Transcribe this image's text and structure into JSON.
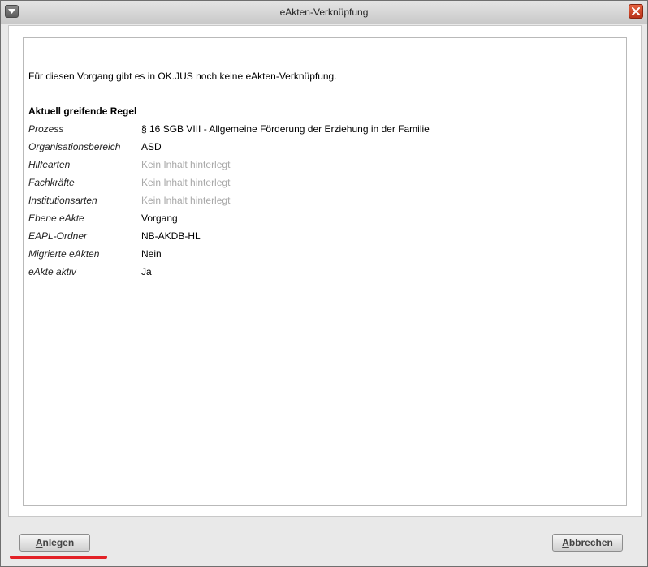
{
  "window": {
    "title": "eAkten-Verknüpfung"
  },
  "content": {
    "intro": "Für diesen Vorgang gibt es in OK.JUS noch keine eAkten-Verknüpfung.",
    "rule_heading": "Aktuell greifende Regel",
    "rows": [
      {
        "label": "Prozess",
        "value": "§ 16 SGB VIII - Allgemeine Förderung der Erziehung in der Familie",
        "empty": false
      },
      {
        "label": "Organisationsbereich",
        "value": "ASD",
        "empty": false
      },
      {
        "label": "Hilfearten",
        "value": "Kein Inhalt hinterlegt",
        "empty": true
      },
      {
        "label": "Fachkräfte",
        "value": "Kein Inhalt hinterlegt",
        "empty": true
      },
      {
        "label": "Institutionsarten",
        "value": "Kein Inhalt hinterlegt",
        "empty": true
      },
      {
        "label": "Ebene eAkte",
        "value": "Vorgang",
        "empty": false
      },
      {
        "label": "EAPL-Ordner",
        "value": "NB-AKDB-HL",
        "empty": false
      },
      {
        "label": "Migrierte eAkten",
        "value": "Nein",
        "empty": false
      },
      {
        "label": "eAkte aktiv",
        "value": "Ja",
        "empty": false
      }
    ]
  },
  "buttons": {
    "create": {
      "mnemonic": "A",
      "rest": "nlegen"
    },
    "cancel": {
      "mnemonic": "A",
      "rest": "bbrechen"
    }
  },
  "colors": {
    "highlight": "#e32127",
    "empty_value": "#a8a8a8"
  }
}
